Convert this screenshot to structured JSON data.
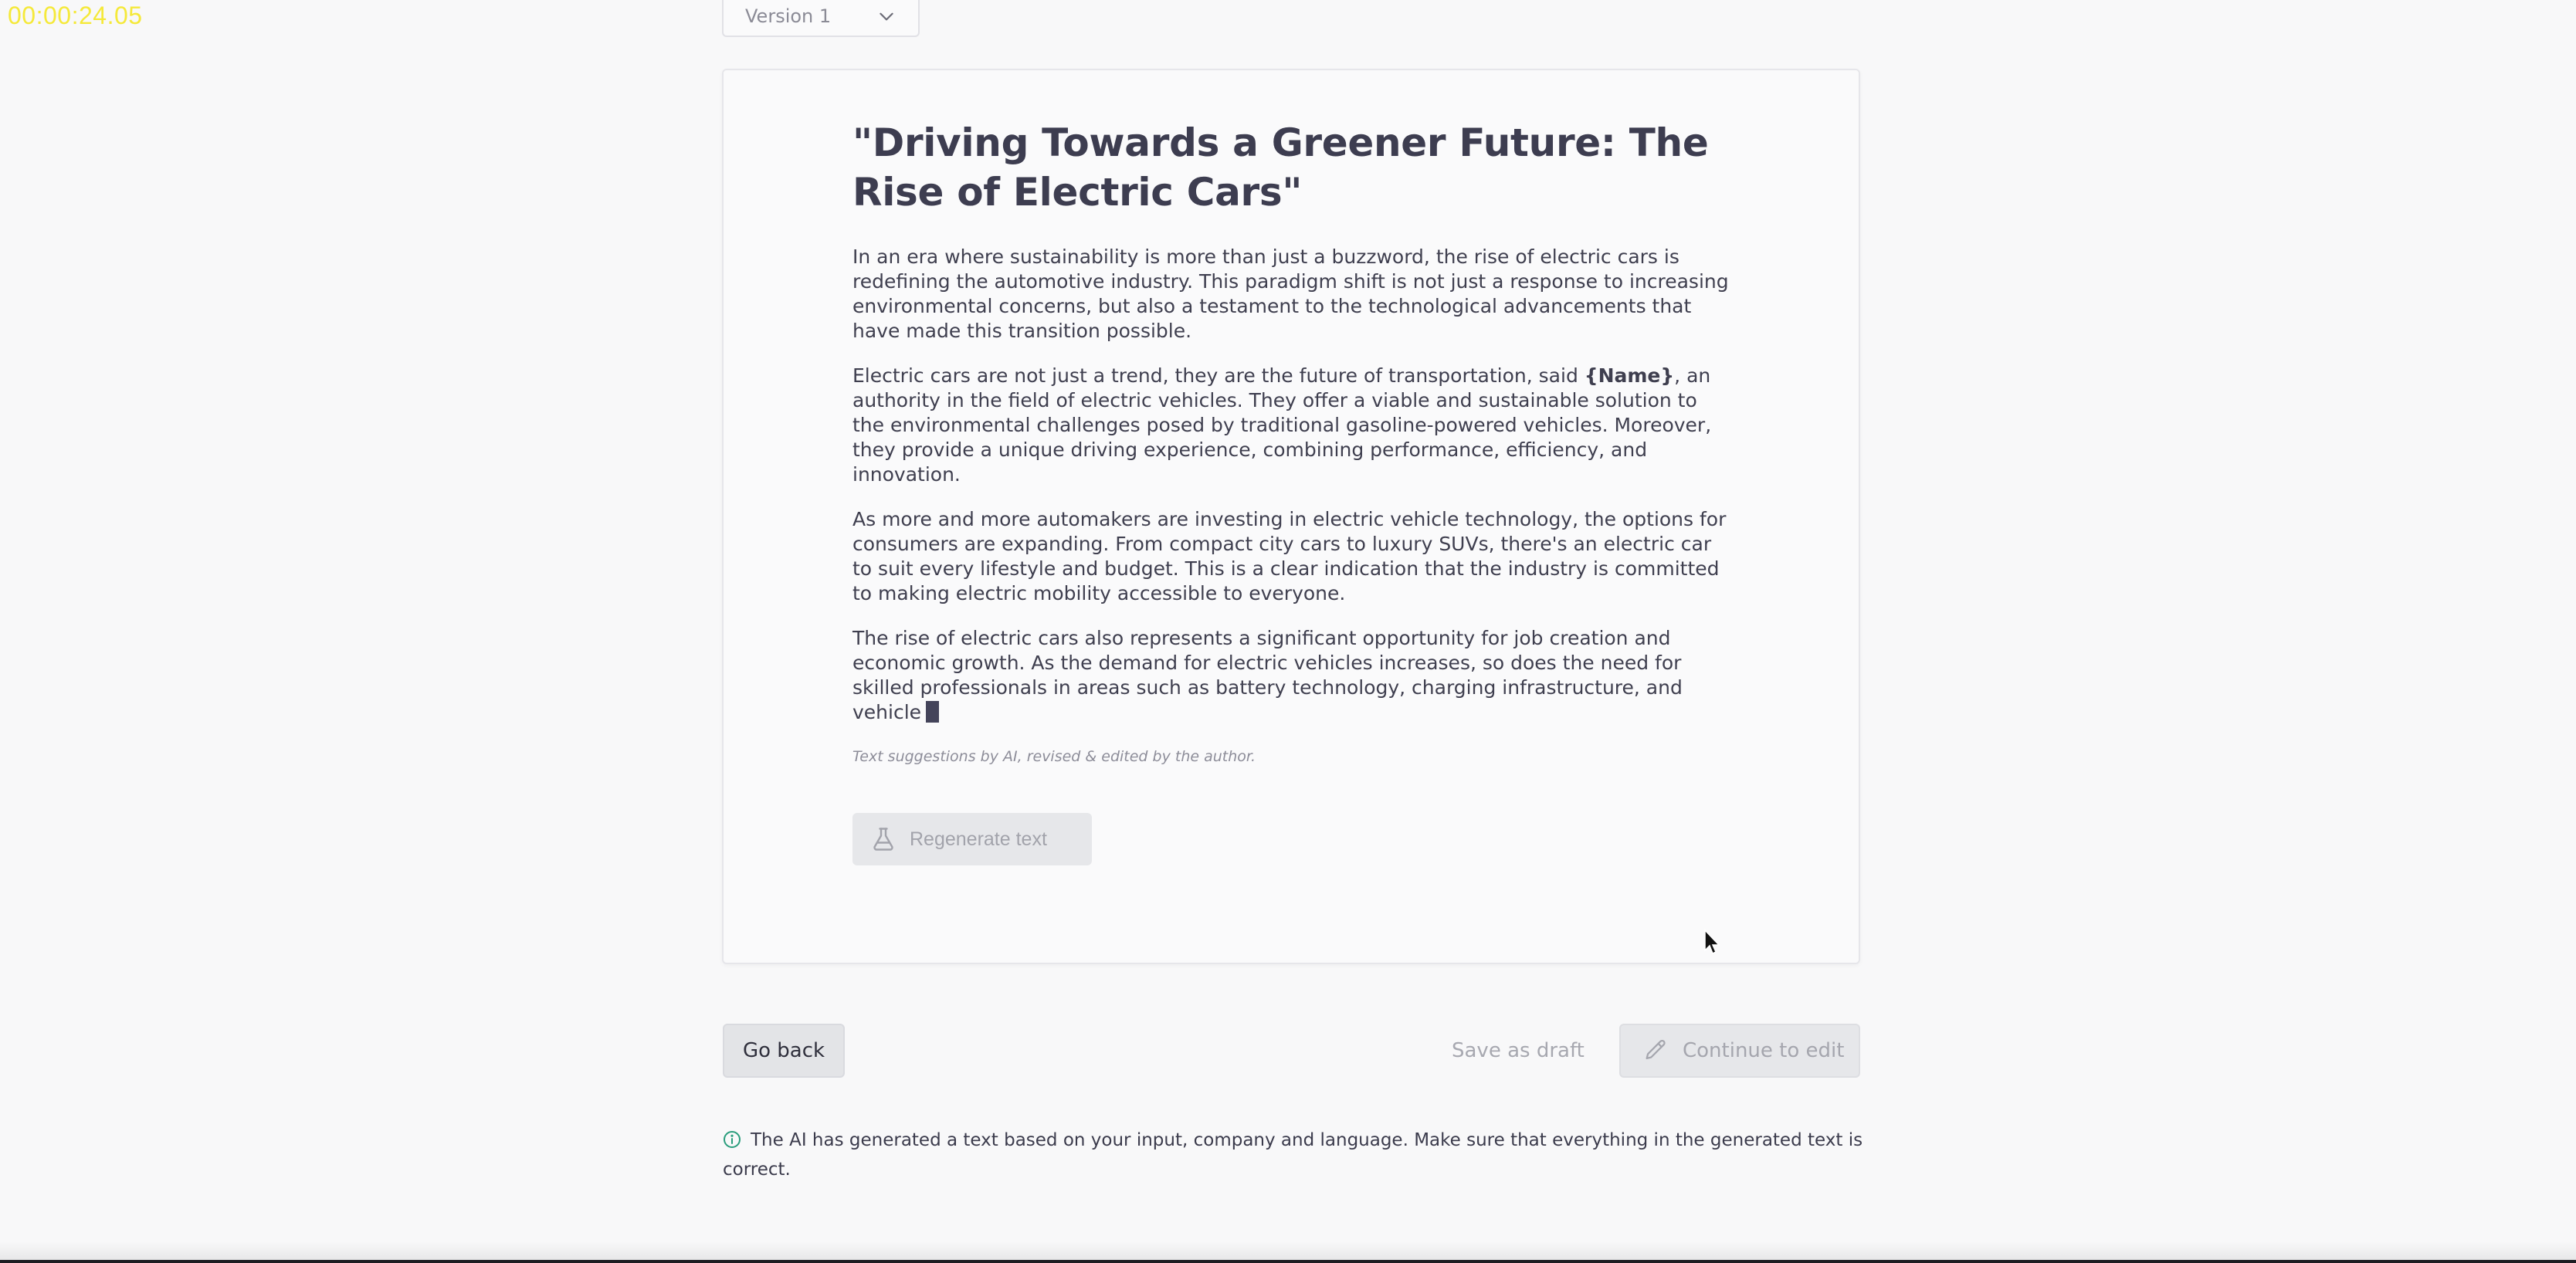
{
  "timer": "00:00:24.05",
  "version_select": {
    "value": "Version 1",
    "icon": "chevron-down-icon"
  },
  "article": {
    "title": "\"Driving Towards a Greener Future: The Rise of Electric Cars\"",
    "p1": "In an era where sustainability is more than just a buzzword, the rise of electric cars is redefining the automotive industry. This paradigm shift is not just a response to increasing environmental concerns, but also a testament to the technological advancements that have made this transition possible.",
    "p2_before": "Electric cars are not just a trend, they are the future of transportation, said ",
    "p2_name": "{Name}",
    "p2_after": ", an authority in the field of electric vehicles. They offer a viable and sustainable solution to the environmental challenges posed by traditional gasoline-powered vehicles. Moreover, they provide a unique driving experience, combining performance, efficiency, and innovation.",
    "p3": "As more and more automakers are investing in electric vehicle technology, the options for consumers are expanding. From compact city cars to luxury SUVs, there's an electric car to suit every lifestyle and budget. This is a clear indication that the industry is committed to making electric mobility accessible to everyone.",
    "p4": "The rise of electric cars also represents a significant opportunity for job creation and economic growth. As the demand for electric vehicles increases, so does the need for skilled professionals in areas such as battery technology, charging infrastructure, and vehicle",
    "ai_note": "Text suggestions by AI, revised & edited by the author."
  },
  "regenerate_button": {
    "label": "Regenerate text",
    "icon": "flask-icon"
  },
  "footer": {
    "go_back_label": "Go back",
    "save_draft_label": "Save as draft",
    "continue_label": "Continue to edit",
    "continue_icon": "pencil-icon"
  },
  "info": {
    "icon": "info-icon",
    "text": "The AI has generated a text based on your input, company and language. Make sure that everything in the generated text is correct."
  },
  "colors": {
    "background": "#f8f8f9",
    "timer": "#f5e93a",
    "info_icon": "#2a9d7c",
    "disabled_text": "#a5a6ae"
  }
}
